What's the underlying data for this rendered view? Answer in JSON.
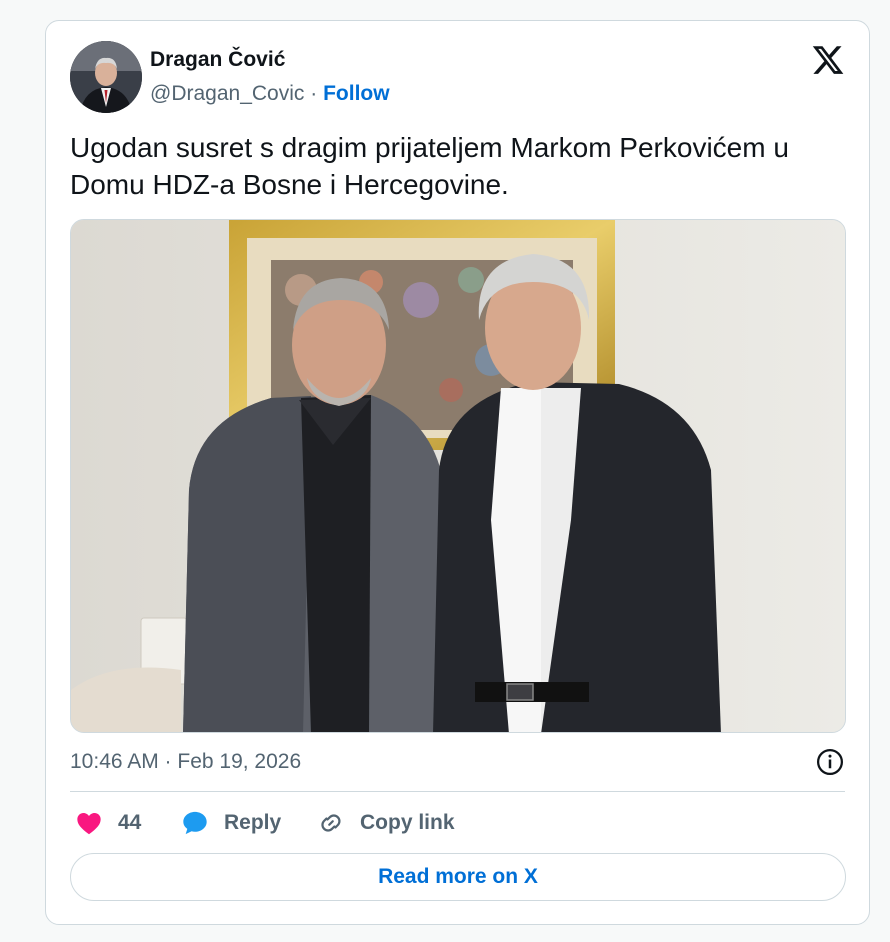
{
  "author": {
    "display_name": "Dragan Čović",
    "handle": "@Dragan_Covic",
    "separator": "·",
    "follow_label": "Follow"
  },
  "tweet": {
    "text": "Ugodan susret s dragim prijateljem Markom Perkovićem u Domu HDZ-a Bosne i Hercegovine.",
    "timestamp": "10:46 AM · Feb 19, 2026"
  },
  "actions": {
    "like_count": "44",
    "reply_label": "Reply",
    "copy_link_label": "Copy link"
  },
  "read_more_label": "Read more on X",
  "colors": {
    "link_blue": "#006fd6",
    "like_pink": "#f91880",
    "reply_blue": "#1d9bf0",
    "muted_text": "#536471",
    "border": "#cfd9de"
  },
  "icons": {
    "brand": "x-logo-icon",
    "info": "info-icon",
    "like": "heart-icon",
    "reply": "speech-bubble-icon",
    "copy": "link-icon"
  }
}
